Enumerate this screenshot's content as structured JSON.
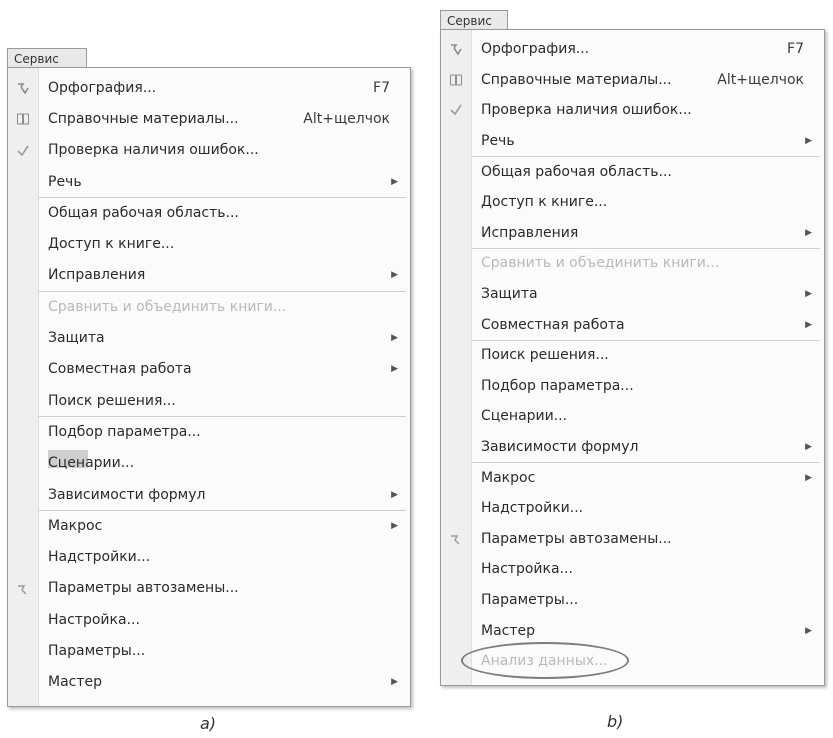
{
  "panel_a": {
    "menu_title": "Сервис",
    "caption": "a)",
    "items": [
      {
        "label": "Орфография...",
        "shortcut": "F7",
        "icon": "spelling-icon"
      },
      {
        "label": "Справочные материалы...",
        "shortcut": "Alt+щелчок",
        "icon": "research-icon"
      },
      {
        "label": "Проверка наличия ошибок...",
        "icon": "error-check-icon"
      },
      {
        "label": "Речь",
        "submenu": true
      },
      {
        "label": "Общая рабочая область..."
      },
      {
        "label": "Доступ к книге..."
      },
      {
        "label": "Исправления",
        "submenu": true
      },
      {
        "label": "Сравнить и объединить книги...",
        "disabled": true
      },
      {
        "label": "Защита",
        "submenu": true
      },
      {
        "label": "Совместная работа",
        "submenu": true
      },
      {
        "label": "Поиск решения..."
      },
      {
        "label": "Подбор параметра..."
      },
      {
        "label": "Сценарии..."
      },
      {
        "label": "Зависимости формул",
        "submenu": true
      },
      {
        "label": "Макрос",
        "submenu": true
      },
      {
        "label": "Надстройки..."
      },
      {
        "label": "Параметры автозамены...",
        "icon": "autocorrect-icon"
      },
      {
        "label": "Настройка..."
      },
      {
        "label": "Параметры..."
      },
      {
        "label": "Мастер",
        "submenu": true
      }
    ]
  },
  "panel_b": {
    "menu_title": "Сервис",
    "caption": "b)",
    "items": [
      {
        "label": "Орфография...",
        "shortcut": "F7",
        "icon": "spelling-icon"
      },
      {
        "label": "Справочные материалы...",
        "shortcut": "Alt+щелчок",
        "icon": "research-icon"
      },
      {
        "label": "Проверка наличия ошибок...",
        "icon": "error-check-icon"
      },
      {
        "label": "Речь",
        "submenu": true
      },
      {
        "label": "Общая рабочая область..."
      },
      {
        "label": "Доступ к книге..."
      },
      {
        "label": "Исправления",
        "submenu": true
      },
      {
        "label": "Сравнить и объединить книги...",
        "disabled": true
      },
      {
        "label": "Защита",
        "submenu": true
      },
      {
        "label": "Совместная работа",
        "submenu": true
      },
      {
        "label": "Поиск решения..."
      },
      {
        "label": "Подбор параметра..."
      },
      {
        "label": "Сценарии..."
      },
      {
        "label": "Зависимости формул",
        "submenu": true
      },
      {
        "label": "Макрос",
        "submenu": true
      },
      {
        "label": "Надстройки..."
      },
      {
        "label": "Параметры автозамены...",
        "icon": "autocorrect-icon"
      },
      {
        "label": "Настройка..."
      },
      {
        "label": "Параметры..."
      },
      {
        "label": "Мастер",
        "submenu": true
      },
      {
        "label": "Анализ данных...",
        "disabled": true,
        "circled": true
      }
    ]
  }
}
